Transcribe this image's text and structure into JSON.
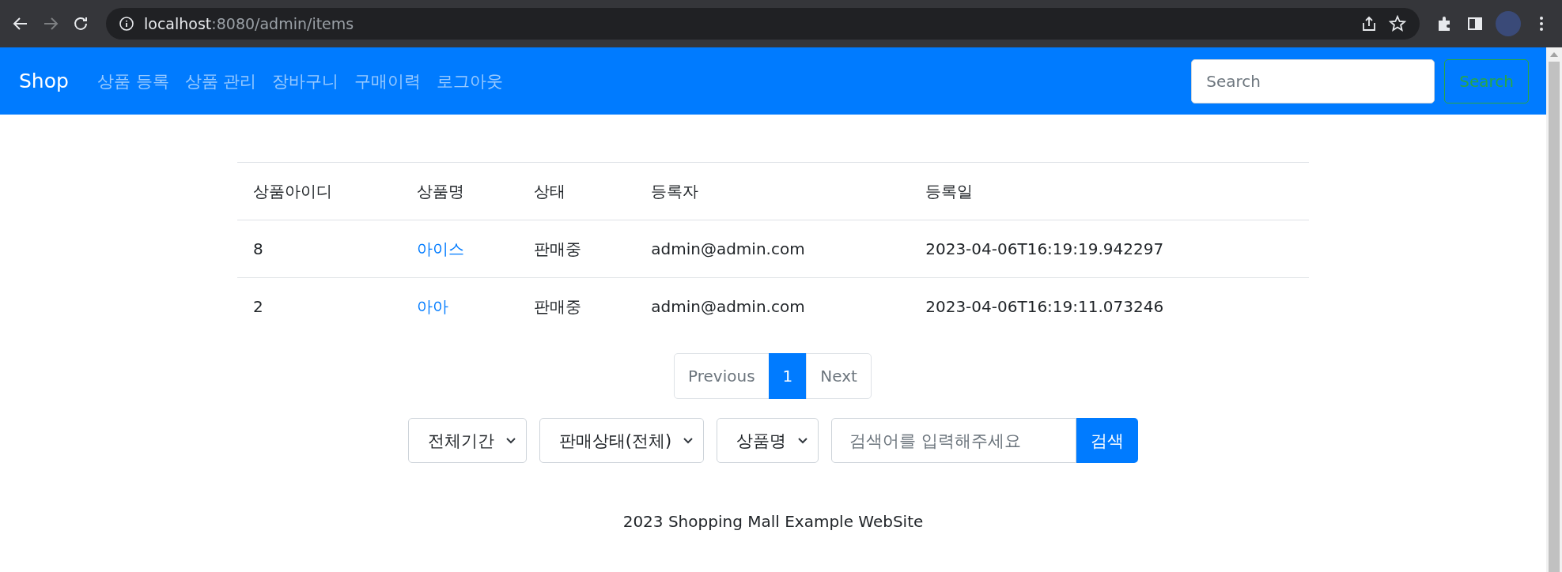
{
  "browser": {
    "url_host": "localhost",
    "url_path": ":8080/admin/items",
    "forward_disabled": true
  },
  "navbar": {
    "brand": "Shop",
    "links": [
      "상품 등록",
      "상품 관리",
      "장바구니",
      "구매이력",
      "로그아웃"
    ],
    "search": {
      "placeholder": "Search",
      "button": "Search"
    }
  },
  "table": {
    "columns": [
      "상품아이디",
      "상품명",
      "상태",
      "등록자",
      "등록일"
    ],
    "rows": [
      {
        "id": "8",
        "name": "아이스",
        "status": "판매중",
        "registrant": "admin@admin.com",
        "date": "2023-04-06T16:19:19.942297"
      },
      {
        "id": "2",
        "name": "아아",
        "status": "판매중",
        "registrant": "admin@admin.com",
        "date": "2023-04-06T16:19:11.073246"
      }
    ]
  },
  "pagination": [
    {
      "label": "Previous",
      "selected": false
    },
    {
      "label": "1",
      "selected": true
    },
    {
      "label": "Next",
      "selected": false
    }
  ],
  "filters": {
    "selects": [
      "전체기간",
      "판매상태(전체)",
      "상품명"
    ],
    "search": {
      "placeholder": "검색어를 입력해주세요"
    },
    "button": "검색"
  },
  "footer": "2023 Shopping Mall Example WebSite"
}
